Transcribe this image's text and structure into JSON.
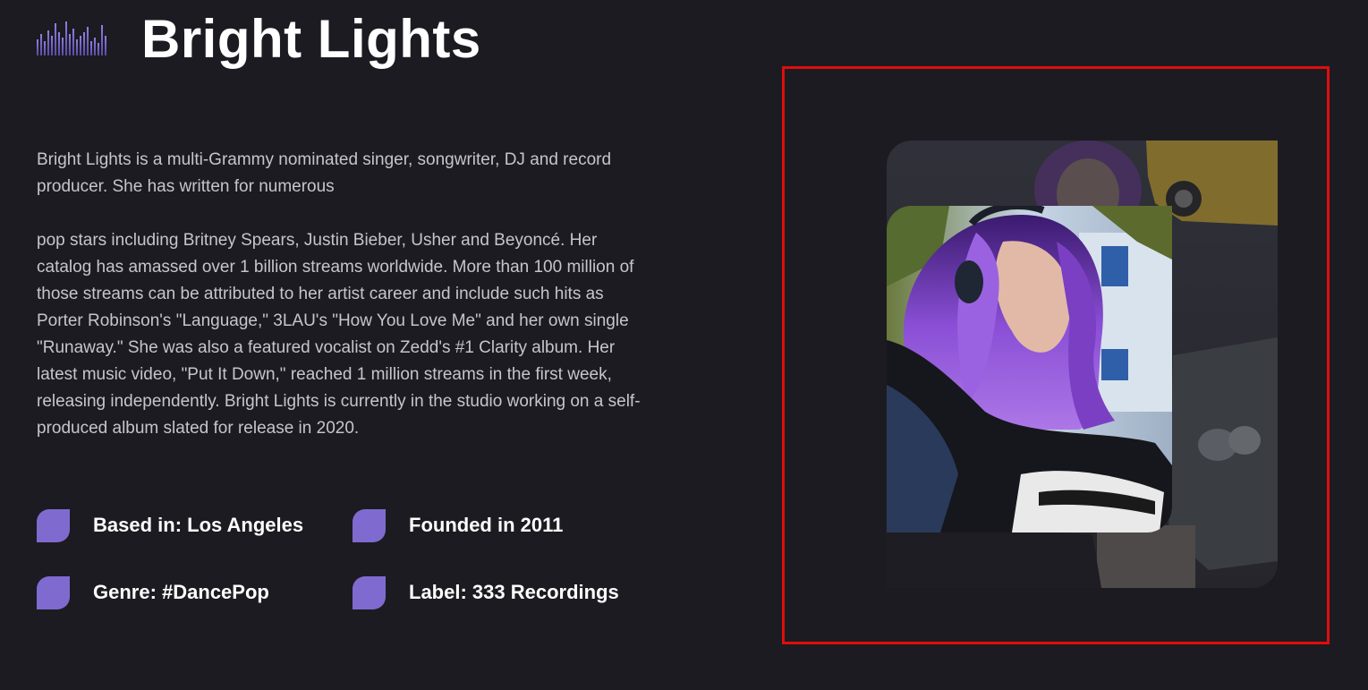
{
  "header": {
    "logo_icon": "equalizer-bars-icon",
    "title": "Bright Lights"
  },
  "bio": {
    "paragraph_1": "Bright Lights is a multi-Grammy nominated singer, songwriter, DJ and record producer. She has written for numerous",
    "paragraph_2": "pop stars including Britney Spears, Justin Bieber, Usher and Beyoncé. Her catalog has amassed over 1 billion streams worldwide. More than 100 million of those streams can be attributed to her artist career and include such hits as Porter Robinson's \"Language,\" 3LAU's \"How You Love Me\" and her own single \"Runaway.\" She was also a featured vocalist on Zedd's #1 Clarity album. Her latest music video, \"Put It Down,\" reached 1 million streams in the first week, releasing independently. Bright Lights is currently in the studio working on a self-produced album slated for release in 2020."
  },
  "facts": [
    {
      "label": "Based in: Los Angeles"
    },
    {
      "label": "Founded in 2011"
    },
    {
      "label": "Genre: #DancePop"
    },
    {
      "label": "Label: 333 Recordings"
    }
  ],
  "colors": {
    "background": "#1c1b21",
    "accent": "#7f6bd0",
    "highlight_border": "#e00d0d",
    "title": "#ffffff",
    "body_text": "#c6c5cc"
  }
}
